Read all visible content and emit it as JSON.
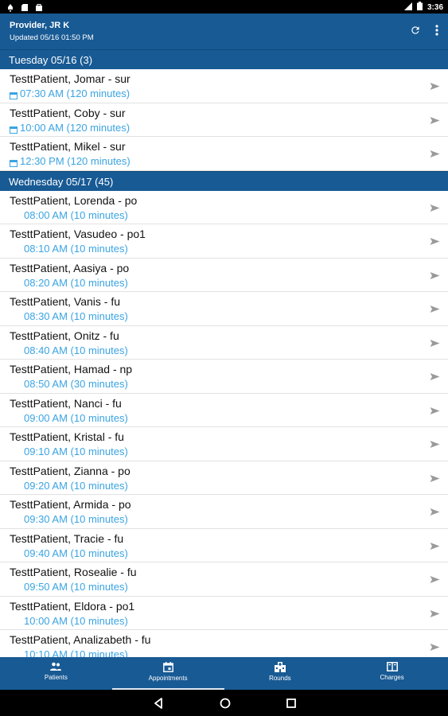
{
  "status_bar": {
    "time": "3:36",
    "left_icons": [
      "notification-icon",
      "sd-card-icon",
      "bag-icon"
    ],
    "right_icons": [
      "signal-icon",
      "battery-icon"
    ]
  },
  "app_bar": {
    "title": "Provider, JR K",
    "subtitle": "Updated 05/16 01:50 PM",
    "actions": [
      "refresh-icon",
      "more-vert-icon"
    ]
  },
  "sections": [
    {
      "header": "Tuesday 05/16 (3)",
      "appointments": [
        {
          "name": "TesttPatient, Jomar - sur",
          "time": "07:30 AM (120 minutes)",
          "has_icon": true
        },
        {
          "name": "TesttPatient, Coby - sur",
          "time": "10:00 AM (120 minutes)",
          "has_icon": true
        },
        {
          "name": "TesttPatient, Mikel - sur",
          "time": "12:30 PM (120 minutes)",
          "has_icon": true
        }
      ]
    },
    {
      "header": "Wednesday 05/17 (45)",
      "appointments": [
        {
          "name": "TesttPatient, Lorenda - po",
          "time": "08:00 AM (10 minutes)",
          "has_icon": false
        },
        {
          "name": "TesttPatient, Vasudeo - po1",
          "time": "08:10 AM (10 minutes)",
          "has_icon": false
        },
        {
          "name": "TesttPatient, Aasiya - po",
          "time": "08:20 AM (10 minutes)",
          "has_icon": false
        },
        {
          "name": "TesttPatient, Vanis - fu",
          "time": "08:30 AM (10 minutes)",
          "has_icon": false
        },
        {
          "name": "TesttPatient, Onitz - fu",
          "time": "08:40 AM (10 minutes)",
          "has_icon": false
        },
        {
          "name": "TesttPatient, Hamad - np",
          "time": "08:50 AM (30 minutes)",
          "has_icon": false
        },
        {
          "name": "TesttPatient, Nanci - fu",
          "time": "09:00 AM (10 minutes)",
          "has_icon": false
        },
        {
          "name": "TesttPatient, Kristal - fu",
          "time": "09:10 AM (10 minutes)",
          "has_icon": false
        },
        {
          "name": "TesttPatient, Zianna - po",
          "time": "09:20 AM (10 minutes)",
          "has_icon": false
        },
        {
          "name": "TesttPatient, Armida - po",
          "time": "09:30 AM (10 minutes)",
          "has_icon": false
        },
        {
          "name": "TesttPatient, Tracie - fu",
          "time": "09:40 AM (10 minutes)",
          "has_icon": false
        },
        {
          "name": "TesttPatient, Rosealie - fu",
          "time": "09:50 AM (10 minutes)",
          "has_icon": false
        },
        {
          "name": "TesttPatient, Eldora - po1",
          "time": "10:00 AM (10 minutes)",
          "has_icon": false
        },
        {
          "name": "TesttPatient, Analizabeth - fu",
          "time": "10:10 AM (10 minutes)",
          "has_icon": false
        }
      ]
    }
  ],
  "bottom_nav": {
    "items": [
      {
        "label": "Patients",
        "icon": "people-icon",
        "active": false
      },
      {
        "label": "Appointments",
        "icon": "calendar-icon",
        "active": true
      },
      {
        "label": "Rounds",
        "icon": "hospital-icon",
        "active": false
      },
      {
        "label": "Charges",
        "icon": "charges-icon",
        "active": false
      }
    ]
  },
  "system_nav": [
    "back-icon",
    "home-icon",
    "recents-icon"
  ],
  "colors": {
    "primary": "#185a94",
    "time_text": "#3aa4e2",
    "divider": "#e2e2e2"
  }
}
